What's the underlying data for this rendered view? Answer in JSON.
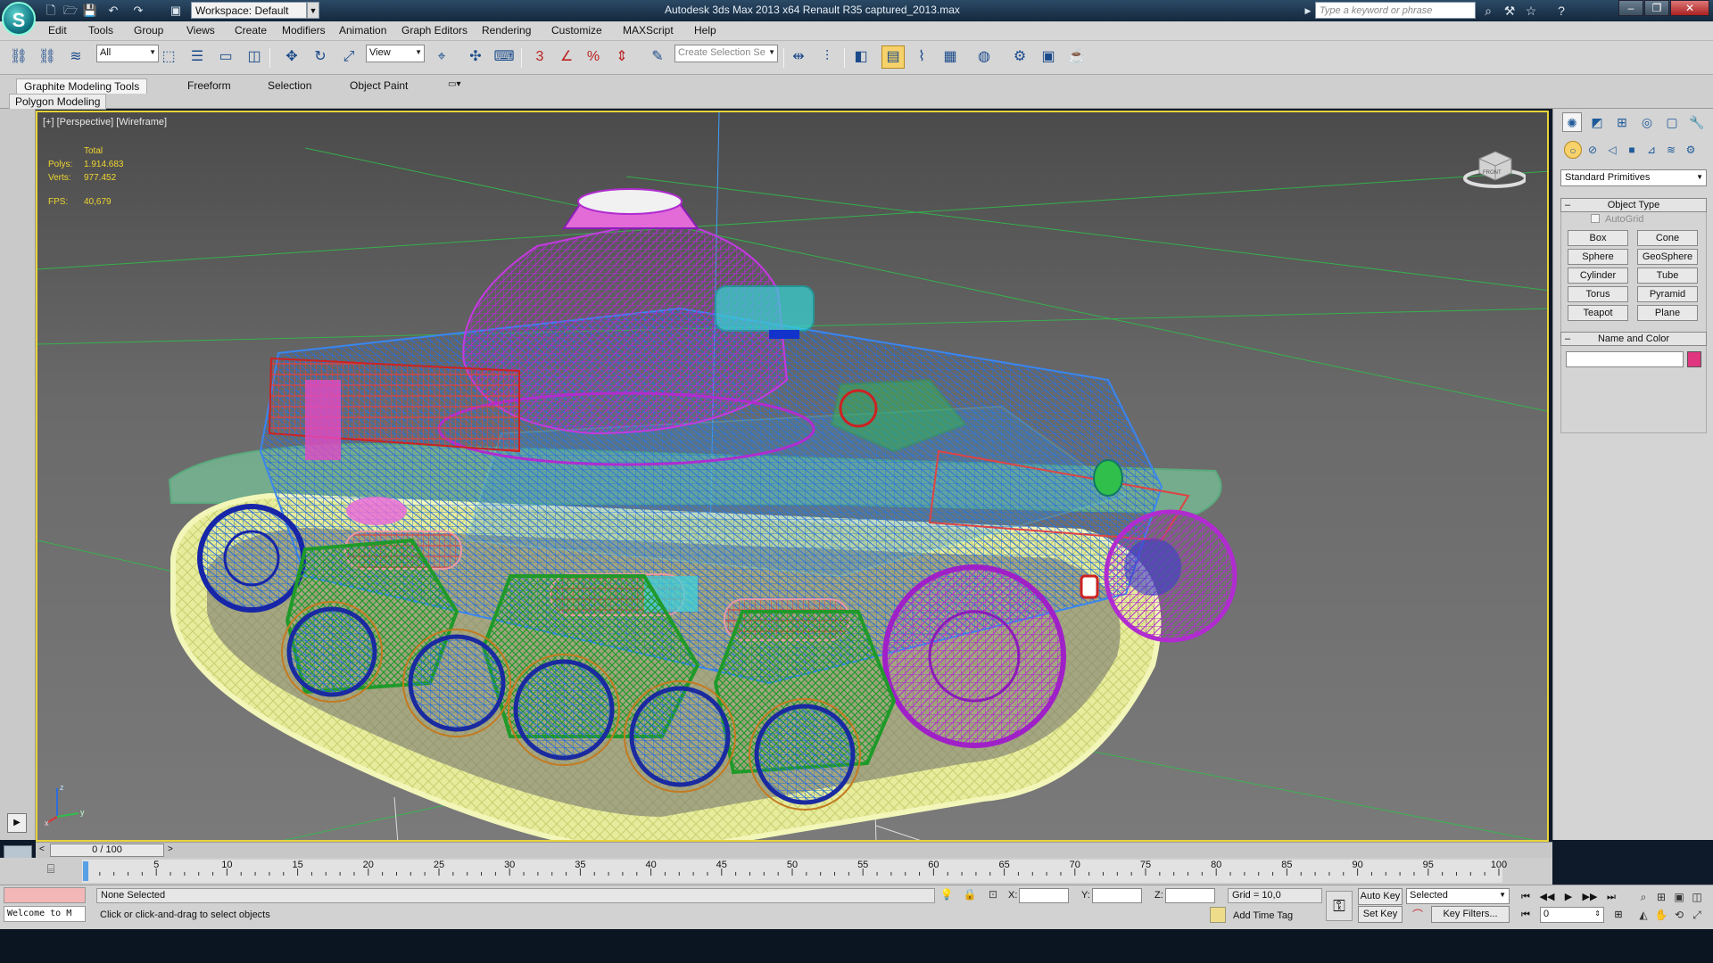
{
  "title_bar": {
    "app_letter": "S",
    "workspace": "Workspace: Default",
    "title": "Autodesk 3ds Max  2013 x64      Renault R35 captured_2013.max",
    "search_placeholder": "Type a keyword or phrase"
  },
  "menu": {
    "items": [
      "Edit",
      "Tools",
      "Group",
      "Views",
      "Create",
      "Modifiers",
      "Animation",
      "Graph Editors",
      "Rendering",
      "Customize",
      "MAXScript",
      "Help"
    ]
  },
  "toolbar": {
    "selection_filter": "All",
    "ref_coord": "View",
    "named_selection_placeholder": "Create Selection Se",
    "snap_3": "3",
    "angle_snap": "∠",
    "percent_snap": "%"
  },
  "ribbon": {
    "tabs": [
      "Graphite Modeling Tools",
      "Freeform",
      "Selection",
      "Object Paint"
    ],
    "panel": "Polygon Modeling"
  },
  "viewport": {
    "label": "[+] [Perspective] [Wireframe]",
    "stats": {
      "header": "Total",
      "polys_label": "Polys:",
      "polys": "1.914.683",
      "verts_label": "Verts:",
      "verts": "977.452",
      "fps_label": "FPS:",
      "fps": "40,679"
    },
    "viewcube_label": "FRONT",
    "axis": {
      "x": "x",
      "y": "y",
      "z": "z"
    },
    "colors": {
      "border": "#e7d33a",
      "track": "#e8eca0",
      "hull": "#2e7bd8",
      "turret": "#a020c8",
      "wheels": "#1f9a2a"
    }
  },
  "command_panel": {
    "category_dropdown": "Standard Primitives",
    "object_type_header": "Object Type",
    "autogrid": "AutoGrid",
    "primitives": [
      "Box",
      "Cone",
      "Sphere",
      "GeoSphere",
      "Cylinder",
      "Tube",
      "Torus",
      "Pyramid",
      "Teapot",
      "Plane"
    ],
    "name_color_header": "Name and Color",
    "object_color": "#e0357f"
  },
  "time_slider": {
    "prev": "<",
    "value": "0 / 100",
    "next": ">"
  },
  "track_bar": {
    "ticks": [
      "0",
      "5",
      "10",
      "15",
      "20",
      "25",
      "30",
      "35",
      "40",
      "45",
      "50",
      "55",
      "60",
      "65",
      "70",
      "75",
      "80",
      "85",
      "90",
      "95",
      "100"
    ]
  },
  "status": {
    "maxscript_text": "Welcome to M",
    "selection": "None Selected",
    "prompt": "Click or click-and-drag to select objects",
    "x_label": "X:",
    "y_label": "Y:",
    "z_label": "Z:",
    "grid": "Grid = 10,0",
    "add_time_tag": "Add Time Tag",
    "auto_key": "Auto Key",
    "set_key": "Set Key",
    "key_mode": "Selected",
    "key_filters": "Key Filters...",
    "frame": "0"
  }
}
